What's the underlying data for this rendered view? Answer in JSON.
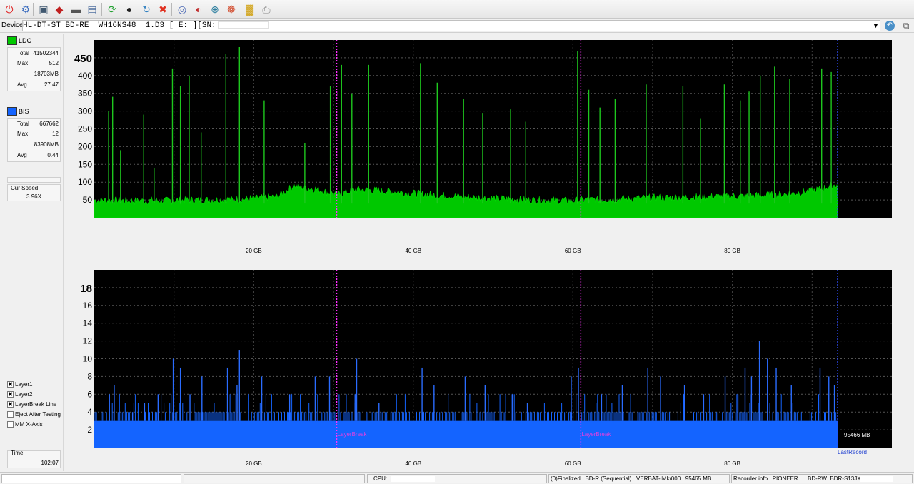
{
  "toolbar": {
    "icons": [
      "exit-icon",
      "probe-icon",
      "device-info-icon",
      "erase-disc-icon",
      "eject-icon",
      "save-icon",
      "start-test-icon",
      "globe-icon",
      "refresh-icon",
      "stop-icon",
      "disc-icon",
      "settings-icon",
      "zoom-icon",
      "screenshot-icon",
      "chart-view-icon",
      "print-icon"
    ]
  },
  "device": {
    "label": "Device:",
    "name": "HL-DT-ST BD-RE  WH16NS48  1.D3 [ E: ][SN:          ]"
  },
  "ldc": {
    "legend": "LDC",
    "color": "#00c800",
    "stats": [
      {
        "key": "Total",
        "value": "41502344"
      },
      {
        "key": "Max",
        "value": "512"
      },
      {
        "key": "",
        "value": "18703MB"
      },
      {
        "key": "Avg",
        "value": "27.47"
      }
    ]
  },
  "bis": {
    "legend": "BIS",
    "color": "#1464ff",
    "stats": [
      {
        "key": "Total",
        "value": "667662"
      },
      {
        "key": "Max",
        "value": "12"
      },
      {
        "key": "",
        "value": "83908MB"
      },
      {
        "key": "Avg",
        "value": "0.44"
      }
    ]
  },
  "speed": {
    "label": "Cur Speed",
    "value": "3.96X"
  },
  "options": [
    {
      "label": "Layer1",
      "checked": true
    },
    {
      "label": "Layer2",
      "checked": true
    },
    {
      "label": "LayerBreak Line",
      "checked": true
    },
    {
      "label": "Eject After Testing",
      "checked": false
    },
    {
      "label": "MM X-Axis",
      "checked": false
    }
  ],
  "time": {
    "label": "Time",
    "value": "102:07"
  },
  "chart_data": [
    {
      "type": "area",
      "name": "LDC chart",
      "x_unit": "GB",
      "xlim": [
        0,
        100
      ],
      "ylim": [
        0,
        500
      ],
      "y_top_label": "450",
      "y_ticks": [
        50,
        100,
        150,
        200,
        250,
        300,
        350,
        400
      ],
      "x_ticks": [
        "20 GB",
        "40 GB",
        "60 GB",
        "80 GB"
      ],
      "x_tick_values": [
        20,
        40,
        60,
        80
      ],
      "layer_breaks": [
        30.4,
        61.0
      ],
      "last_record": 93.2,
      "series_color": "#00c800",
      "baseline": [
        [
          0,
          45
        ],
        [
          5,
          43
        ],
        [
          10,
          44
        ],
        [
          15,
          46
        ],
        [
          19,
          48
        ],
        [
          23,
          55
        ],
        [
          25,
          85
        ],
        [
          28,
          75
        ],
        [
          30.4,
          60
        ],
        [
          33,
          75
        ],
        [
          37,
          70
        ],
        [
          41,
          62
        ],
        [
          46,
          55
        ],
        [
          50,
          50
        ],
        [
          55,
          45
        ],
        [
          60,
          43
        ],
        [
          61,
          45
        ],
        [
          66,
          48
        ],
        [
          71,
          52
        ],
        [
          76,
          54
        ],
        [
          81,
          56
        ],
        [
          86,
          60
        ],
        [
          90,
          70
        ],
        [
          93.2,
          90
        ]
      ],
      "spikes": [
        [
          1.8,
          300
        ],
        [
          2.3,
          340
        ],
        [
          3.3,
          190
        ],
        [
          6.2,
          290
        ],
        [
          7.5,
          140
        ],
        [
          9.8,
          420
        ],
        [
          10.8,
          370
        ],
        [
          11.9,
          400
        ],
        [
          13.4,
          240
        ],
        [
          16.5,
          460
        ],
        [
          18.2,
          480
        ],
        [
          21.3,
          330
        ],
        [
          26.4,
          210
        ],
        [
          29.6,
          370
        ],
        [
          31.0,
          430
        ],
        [
          32.3,
          350
        ],
        [
          34.4,
          430
        ],
        [
          40.9,
          435
        ],
        [
          43.0,
          380
        ],
        [
          46.3,
          335
        ],
        [
          48.7,
          295
        ],
        [
          52.2,
          305
        ],
        [
          54.1,
          270
        ],
        [
          60.6,
          470
        ],
        [
          62.0,
          360
        ],
        [
          63.4,
          310
        ],
        [
          65.3,
          335
        ],
        [
          69.2,
          375
        ],
        [
          73.8,
          370
        ],
        [
          76.0,
          280
        ],
        [
          79.0,
          375
        ],
        [
          81.0,
          330
        ],
        [
          82.1,
          355
        ],
        [
          83.5,
          400
        ],
        [
          85.3,
          425
        ],
        [
          87.2,
          390
        ],
        [
          91.2,
          420
        ],
        [
          92.4,
          410
        ]
      ]
    },
    {
      "type": "bar",
      "name": "BIS chart",
      "x_unit": "GB",
      "xlim": [
        0,
        100
      ],
      "ylim": [
        0,
        20
      ],
      "y_top_label": "18",
      "y_ticks": [
        2,
        4,
        6,
        8,
        10,
        12,
        14,
        16
      ],
      "x_ticks": [
        "20 GB",
        "40 GB",
        "60 GB",
        "80 GB"
      ],
      "x_tick_values": [
        20,
        40,
        60,
        80
      ],
      "layer_breaks": [
        30.4,
        61.0
      ],
      "layer_break_label": "LayerBreak",
      "last_record": 93.2,
      "last_record_label": "LastRecord",
      "end_value_label": "95466 MB",
      "series_color": "#1464ff",
      "base_level": 3,
      "spikes": [
        [
          1.9,
          6
        ],
        [
          2.5,
          7
        ],
        [
          4.8,
          4
        ],
        [
          6.3,
          5
        ],
        [
          8.0,
          6
        ],
        [
          9.9,
          10
        ],
        [
          10.8,
          9
        ],
        [
          12.0,
          6
        ],
        [
          13.5,
          8
        ],
        [
          16.7,
          9
        ],
        [
          17.9,
          7
        ],
        [
          18.2,
          11
        ],
        [
          21.0,
          8
        ],
        [
          24.5,
          6
        ],
        [
          27.7,
          8
        ],
        [
          29.5,
          8
        ],
        [
          32.7,
          6
        ],
        [
          32.9,
          10
        ],
        [
          35.7,
          5
        ],
        [
          41.1,
          9
        ],
        [
          42.6,
          7
        ],
        [
          46.5,
          8
        ],
        [
          49.0,
          7
        ],
        [
          52.4,
          6
        ],
        [
          54.3,
          5
        ],
        [
          59.8,
          8
        ],
        [
          60.7,
          9
        ],
        [
          63.6,
          6
        ],
        [
          66.2,
          7
        ],
        [
          69.4,
          9
        ],
        [
          71.0,
          8
        ],
        [
          74.0,
          7
        ],
        [
          76.4,
          6
        ],
        [
          79.1,
          8
        ],
        [
          80.7,
          6
        ],
        [
          81.6,
          9
        ],
        [
          82.4,
          8
        ],
        [
          83.4,
          12
        ],
        [
          84.4,
          10
        ],
        [
          85.5,
          9
        ],
        [
          87.4,
          7
        ],
        [
          91.0,
          9
        ],
        [
          92.1,
          8
        ],
        [
          92.8,
          7
        ]
      ]
    }
  ],
  "status": {
    "cpu_label": "CPU:",
    "disc": "(0)Finalized   BD-R (Sequential)   VERBAT-IMk/000   95465 MB",
    "recorder_label": "Recorder info : PIONEER",
    "recorder_model": "BD-RW  BDR-S13JX"
  }
}
